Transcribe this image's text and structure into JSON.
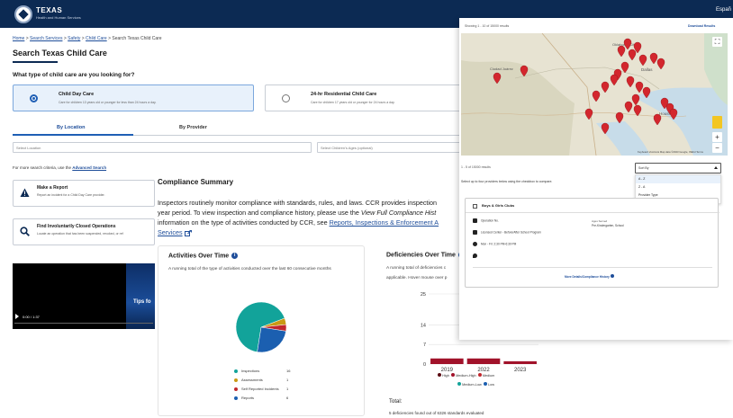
{
  "header": {
    "logo_title": "TEXAS",
    "logo_subtitle": "Health and Human Services",
    "right_text": "Españ"
  },
  "breadcrumb": {
    "items": [
      "Home",
      "Search Services",
      "Safety",
      "Child Care"
    ],
    "current": "Search Texas Child Care",
    "separator": ">"
  },
  "page": {
    "title": "Search Texas Child Care",
    "question": "What type of child care are you looking for?"
  },
  "care_types": [
    {
      "title": "Child Day Care",
      "description": "Care for children 13 years old or younger for less than 24 hours a day.",
      "selected": true
    },
    {
      "title": "24-hr Residential Child Care",
      "description": "Care for children 17 years old or younger for 24 hours a day.",
      "selected": false
    }
  ],
  "tabs": [
    "By Location",
    "By Provider"
  ],
  "fields": {
    "location_placeholder": "Select Location",
    "ages_placeholder": "Select Children's Ages (optional)"
  },
  "advanced": {
    "prefix": "For more search criteria, use the",
    "link": "Advanced Search"
  },
  "cards": [
    {
      "title": "Make a Report",
      "description": "Report an incident for a Child Day Care provider.",
      "icon": "warning-icon"
    },
    {
      "title": "Find Involuntarily Closed Operations",
      "description": "Locate an operation that has been suspended, revoked, or ref",
      "icon": "search-icon"
    }
  ],
  "video": {
    "caption": "Tips fo",
    "time": "0:00 / 1:37"
  },
  "compliance": {
    "title": "Compliance Summary",
    "text_a": "Inspectors routinely monitor compliance with standards, rules, and laws. CCR provides inspection",
    "text_b": "year period. To view inspection and compliance history, please use the",
    "text_b_italic": "View Full Compliance Hist",
    "text_c": "information on the type of activities conducted by CCR, see",
    "text_c_link": "Reports, Inspections & Enforcement A",
    "text_d_link": "Services"
  },
  "activities": {
    "title": "Activities Over Time",
    "description": "A running total of the type of activities conducted over the last 60 consecutive months",
    "legend": [
      {
        "label": "Inspections",
        "value": "16",
        "color": "#12a39a"
      },
      {
        "label": "Assessments",
        "value": "1",
        "color": "#c99a14"
      },
      {
        "label": "Self Reported Incidents",
        "value": "1",
        "color": "#c1272d"
      },
      {
        "label": "Reports",
        "value": "6",
        "color": "#1b5fb0"
      }
    ]
  },
  "deficiencies": {
    "title": "Deficiencies Over Time",
    "description_a": "A running total of deficiencies c",
    "description_b": "applicable. Hover mouse over p",
    "legend": [
      {
        "label": "High",
        "color": "#5a0b12"
      },
      {
        "label": "Medium-High",
        "color": "#a1122a"
      },
      {
        "label": "Medium",
        "color": "#c1272d"
      },
      {
        "label": "Medium-Low",
        "color": "#12a39a"
      },
      {
        "label": "Low",
        "color": "#1b5fb0"
      }
    ],
    "total_label": "Total:",
    "total_text": "5 deficiencies found out of 6326 standards evaluated"
  },
  "chart_data": [
    {
      "type": "pie",
      "title": "Activities Over Time",
      "categories": [
        "Inspections",
        "Assessments",
        "Self Reported Incidents",
        "Reports"
      ],
      "values": [
        16,
        1,
        1,
        6
      ]
    },
    {
      "type": "bar",
      "title": "Deficiencies Over Time",
      "categories": [
        "2019",
        "2022",
        "2023"
      ],
      "values": [
        2,
        2,
        1
      ],
      "ylim": [
        0,
        25
      ],
      "yticks": [
        "25",
        "14",
        "7",
        "0"
      ]
    }
  ],
  "results": {
    "count_top": "1 - 10 of 15000 results",
    "count_top_prefix": "Showing",
    "download": "Download Results",
    "count_mid": "1 - 5 of 15000 results",
    "select_note": "Select up to four providers below using the checkbox to compare.",
    "sort_label": "Sort By",
    "sort_options": [
      "A - Z",
      "Z - A",
      "Provider Type"
    ],
    "map_city_dallas": "Dallas",
    "map_city_houston": "Houston",
    "map_city_juarez": "Ciudad Juárez",
    "map_city_okc": "Oklahoma City",
    "map_attribution": "Keyboard shortcuts  Map data ©2023 Google, INEGI  Terms"
  },
  "provider": {
    "name": "Boys & Girls Clubs",
    "operation_label": "Operation No.",
    "type": "Licensed Center - Before/After School Program",
    "hours": "Mon - Fri: 2:30 PM-6:30 PM",
    "age_label": "Ages Served",
    "ages": "Pre-Kindergarten, School",
    "more": "More Details/Compliance History"
  }
}
